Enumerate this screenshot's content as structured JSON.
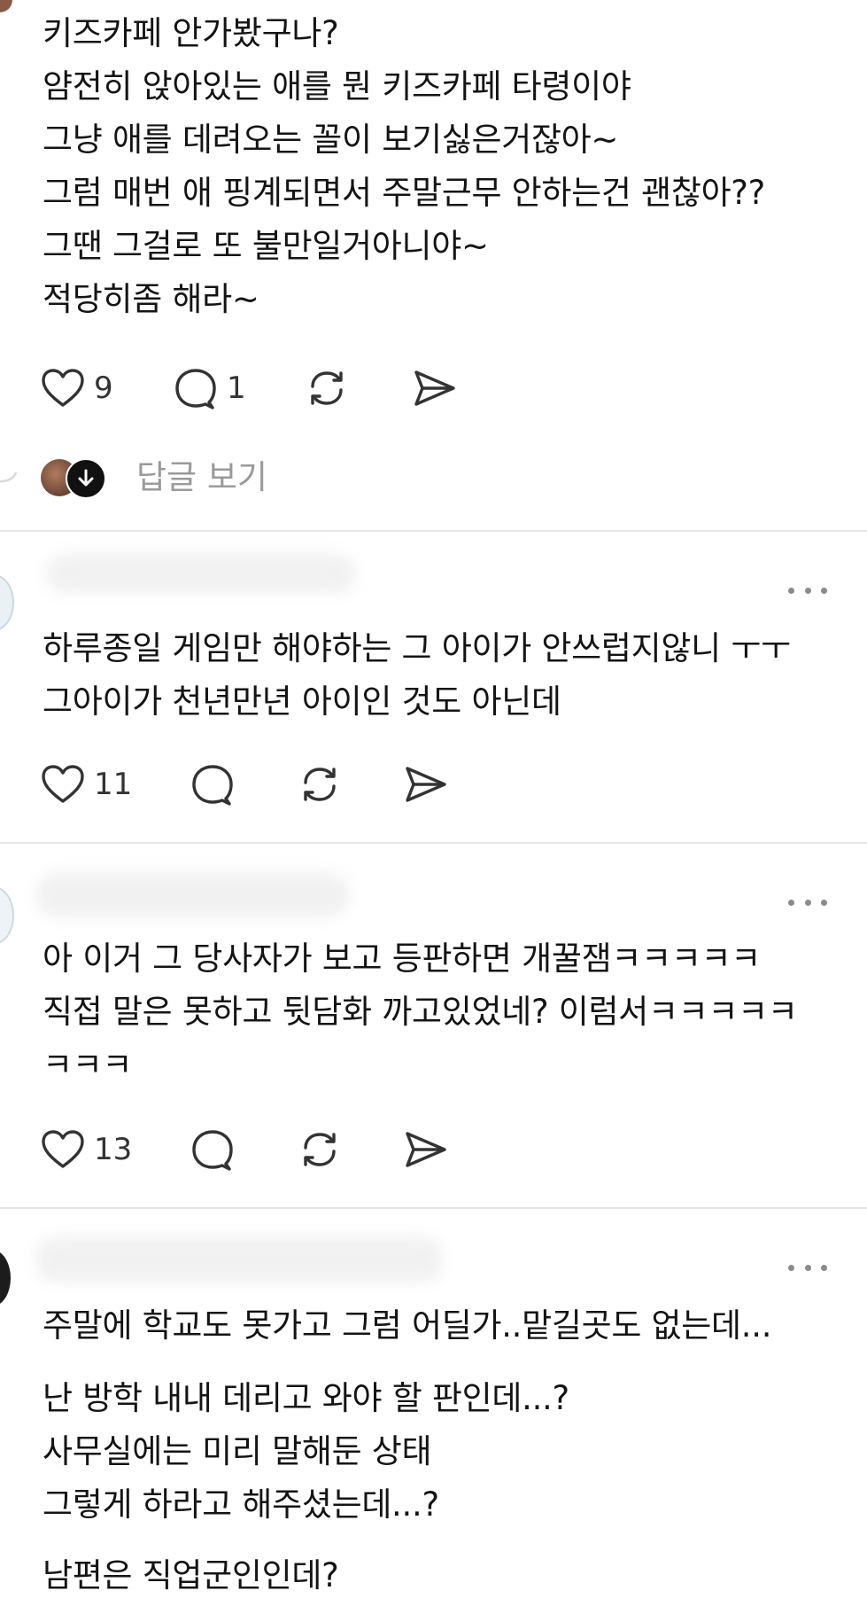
{
  "comments": [
    {
      "lines": [
        "키즈카페 안가봤구나?",
        "얌전히 앉아있는 애를 뭔 키즈카페 타령이야",
        "그냥 애를 데려오는 꼴이 보기싫은거잖아~",
        "그럼 매번 애 핑계되면서 주말근무 안하는건 괜찮아??",
        "그땐 그걸로 또 불만일거아니야~",
        "적당히좀 해라~"
      ],
      "likes": "9",
      "replies": "1",
      "view_replies_label": "답글 보기"
    },
    {
      "lines": [
        "하루종일 게임만 해야하는 그 아이가 안쓰럽지않니 ㅜㅜ",
        "그아이가 천년만년 아이인 것도 아닌데"
      ],
      "likes": "11"
    },
    {
      "lines": [
        "아 이거 그 당사자가 보고 등판하면 개꿀잼ㅋㅋㅋㅋㅋ",
        "직접 말은 못하고 뒷담화 까고있었네? 이럼서ㅋㅋㅋㅋㅋ",
        "ㅋㅋㅋ"
      ],
      "likes": "13"
    },
    {
      "lines": [
        "주말에 학교도 못가고 그럼 어딜가..맡길곳도 없는데...",
        "난 방학 내내 데리고 와야 할 판인데...?",
        "사무실에는 미리 말해둔 상태",
        "그렇게 하라고 해주셨는데...?",
        "남편은 직업군인인데?"
      ]
    }
  ],
  "icons": {
    "like": "heart-icon",
    "comment": "comment-icon",
    "repost": "repost-icon",
    "share": "send-icon",
    "more": "more-options-icon",
    "down_arrow": "arrow-down-icon"
  }
}
